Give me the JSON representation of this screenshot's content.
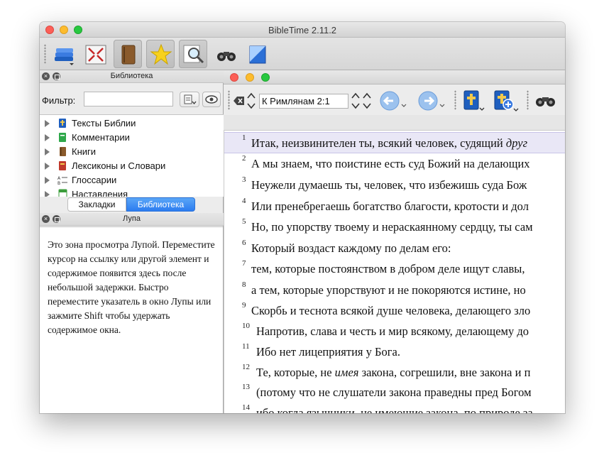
{
  "window": {
    "title": "BibleTime 2.11.2"
  },
  "library": {
    "title": "Библиотека",
    "filter_label": "Фильтр:",
    "filter_value": "",
    "items": [
      {
        "label": "Тексты Библии",
        "icon": "bible-texts-icon",
        "color": "#1f5fbf"
      },
      {
        "label": "Комментарии",
        "icon": "commentary-icon",
        "color": "#2ea84a"
      },
      {
        "label": "Книги",
        "icon": "book-icon",
        "color": "#8a5a2b"
      },
      {
        "label": "Лексиконы и Словари",
        "icon": "lexicon-icon",
        "color": "#c0392b"
      },
      {
        "label": "Глоссарии",
        "icon": "glossary-icon",
        "color": "#555555"
      },
      {
        "label": "Наставления",
        "icon": "devotional-icon",
        "color": "#3b9d3b"
      }
    ],
    "tabs": [
      {
        "label": "Закладки",
        "active": false
      },
      {
        "label": "Библиотека",
        "active": true
      }
    ]
  },
  "magnifier": {
    "title": "Лупа",
    "text": "Это зона просмотра Лупой. Переместите курсор на ссылку или другой элемент и содержимое появится здесь после небольшой задержки. Быстро переместите указатель в окно Лупы или зажмите Shift чтобы удержать содержимое окна."
  },
  "reader": {
    "key": "К Римлянам 2:1",
    "verses": [
      {
        "num": "1",
        "pre": "Итак, неизвинителен ты, всякий человек, судящий ",
        "it": "друг",
        "post": ""
      },
      {
        "num": "2",
        "pre": "А мы знаем, что поистине есть суд Божий на делающих",
        "it": "",
        "post": ""
      },
      {
        "num": "3",
        "pre": "Неужели думаешь ты, человек, что избежишь суда Бож",
        "it": "",
        "post": ""
      },
      {
        "num": "4",
        "pre": "Или пренебрегаешь богатство благости, кротости и дол",
        "it": "",
        "post": ""
      },
      {
        "num": "5",
        "pre": "Но, по упорству твоему и нераскаянному сердцу, ты сам",
        "it": "",
        "post": ""
      },
      {
        "num": "6",
        "pre": "Который воздаст каждому по делам его:",
        "it": "",
        "post": ""
      },
      {
        "num": "7",
        "pre": "тем, которые постоянством в добром деле ищут славы, ",
        "it": "",
        "post": ""
      },
      {
        "num": "8",
        "pre": "а тем, которые упорствуют и не покоряются истине, но ",
        "it": "",
        "post": ""
      },
      {
        "num": "9",
        "pre": "Скорбь и теснота всякой душе человека, делающего зло",
        "it": "",
        "post": ""
      },
      {
        "num": "10",
        "pre": "Напротив, слава и честь и мир всякому, делающему до",
        "it": "",
        "post": ""
      },
      {
        "num": "11",
        "pre": "Ибо нет лицеприятия у Бога.",
        "it": "",
        "post": ""
      },
      {
        "num": "12",
        "pre": "Те, которые, не ",
        "it": "имея",
        "post": " закона, согрешили, вне закона и п"
      },
      {
        "num": "13",
        "pre": "(потому что не слушатели закона праведны пред Богом",
        "it": "",
        "post": ""
      },
      {
        "num": "14",
        "pre": "ибо когда язычники, не имеющие закона, по природе за",
        "it": "",
        "post": ""
      }
    ]
  },
  "colors": {
    "accent": "#2c7cf0",
    "highlight": "#e9e7f6"
  }
}
